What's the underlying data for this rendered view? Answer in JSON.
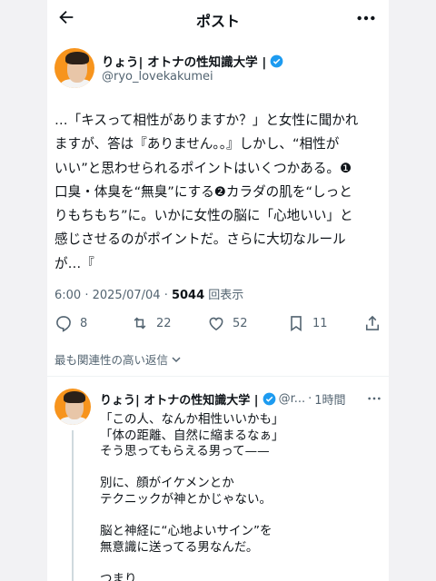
{
  "header": {
    "title": "ポスト"
  },
  "post": {
    "author_name": "りょう| オトナの性知識大学 |",
    "handle": "@ryo_lovekakumei",
    "lines": [
      "…「キスって相性がありますか？」と女性に聞かれ",
      "ますが、答は『ありません。。』しかし、“相性が",
      "いい”と思わせられるポイントはいくつかある。❶",
      "口臭・体臭を“無臭”にする❷カラダの肌を“しっと",
      "りもちもち”に。いかに女性の脳に「心地いい」と",
      "感じさせるのがポイントだ。さらに大切なルール",
      "が…『"
    ],
    "time": "6:00",
    "date": "2025/07/04",
    "views_count": "5044",
    "views_label": "回表示"
  },
  "actions": {
    "replies": "8",
    "reposts": "22",
    "likes": "52",
    "bookmarks": "11"
  },
  "sort_label": "最も関連性の高い返信",
  "reply": {
    "author_name": "りょう| オトナの性知識大学 |",
    "handle": "@r...",
    "time": "1時間",
    "lines": [
      "「この人、なんか相性いいかも」",
      "「体の距離、自然に縮まるなぁ」",
      "そう思ってもらえる男って——",
      "",
      "別に、顔がイケメンとか",
      "テクニックが神とかじゃない。",
      "",
      "脳と神経に“心地よいサイン”を",
      "無意識に送ってる男なんだ。",
      "",
      "つまり"
    ]
  },
  "colors": {
    "verified": "#1d9bf0",
    "avatar_bg": "#f7941d",
    "muted": "#536471"
  }
}
